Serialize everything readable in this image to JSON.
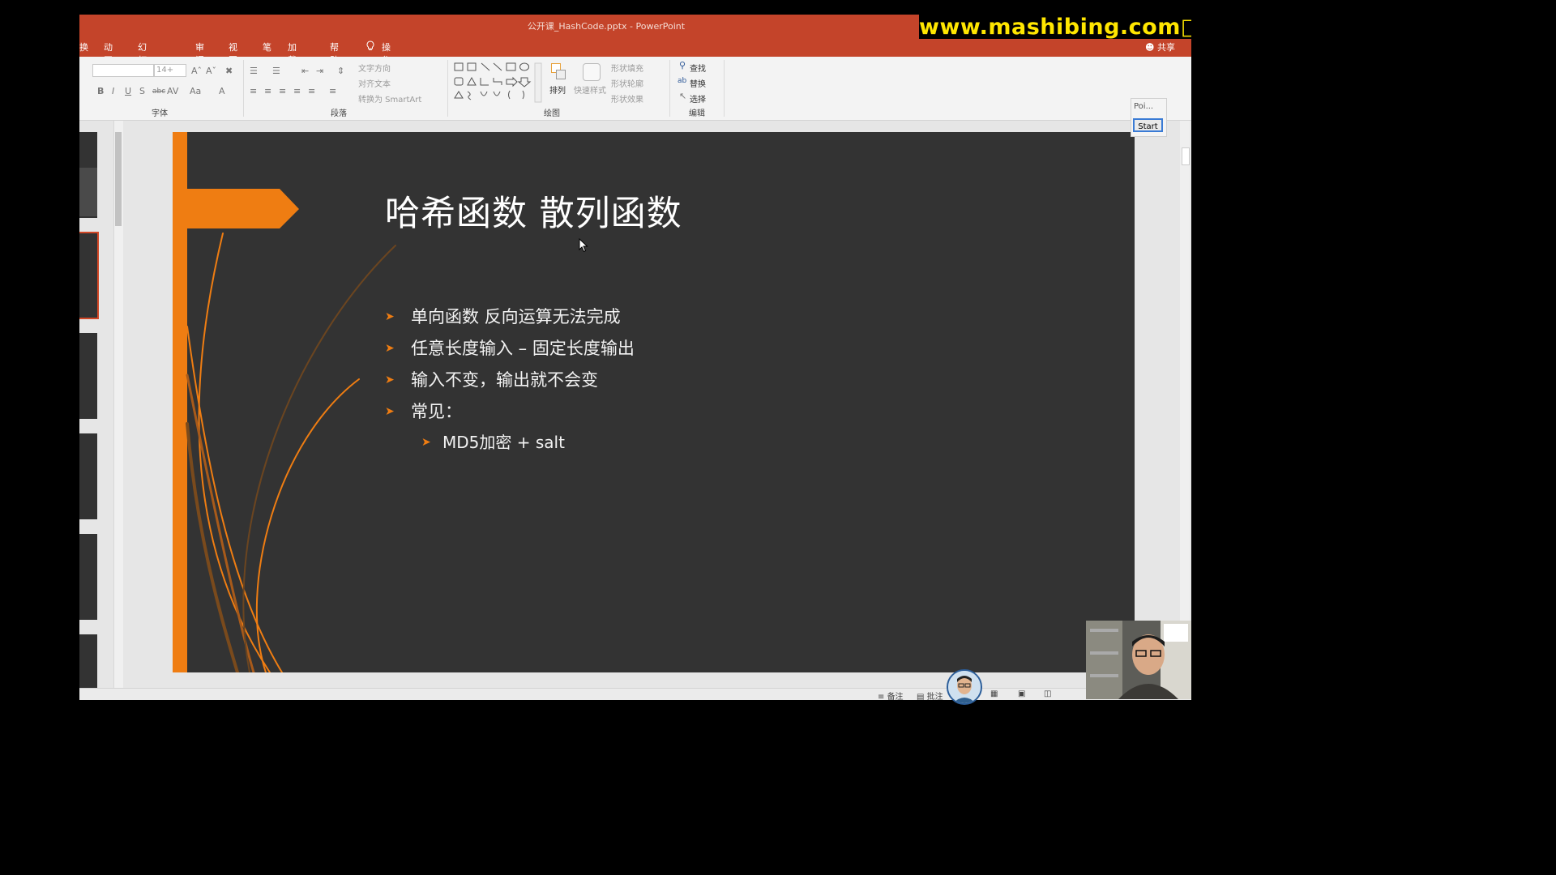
{
  "window": {
    "title": "公开课_HashCode.pptx  -  PowerPoint",
    "watermark": "www.mashibing.com□",
    "share_label": "共享"
  },
  "menu": {
    "items": [
      "换",
      "动画",
      "幻灯片放映",
      "审阅",
      "视图",
      "笔",
      "加载项",
      "帮助",
      "操作说明搜索"
    ],
    "search_icon": "lightbulb-icon"
  },
  "ribbon": {
    "font": {
      "font_size_value": "14+",
      "label": "字体"
    },
    "paragraph": {
      "label": "段落",
      "text_direction": "文字方向",
      "align_text": "对齐文本",
      "convert_smartart": "转换为 SmartArt"
    },
    "drawing": {
      "label": "绘图",
      "arrange": "排列",
      "quick_styles": "快速样式",
      "shape_fill": "形状填充",
      "shape_outline": "形状轮廓",
      "shape_effects": "形状效果"
    },
    "editing": {
      "label": "编辑",
      "find": "查找",
      "replace": "替换",
      "select": "选择"
    }
  },
  "slide": {
    "title": "哈希函数 散列函数",
    "bullets": [
      "单向函数 反向运算无法完成",
      "任意长度输入 – 固定长度输出",
      "输入不变，输出就不会变",
      "常见："
    ],
    "sub_bullets": [
      "MD5加密 + salt"
    ],
    "accent_color": "#ef7d12",
    "background_color": "#333333"
  },
  "addin": {
    "title": "Poi...",
    "start_label": "Start"
  },
  "status": {
    "notes": "备注",
    "comments": "批注"
  }
}
